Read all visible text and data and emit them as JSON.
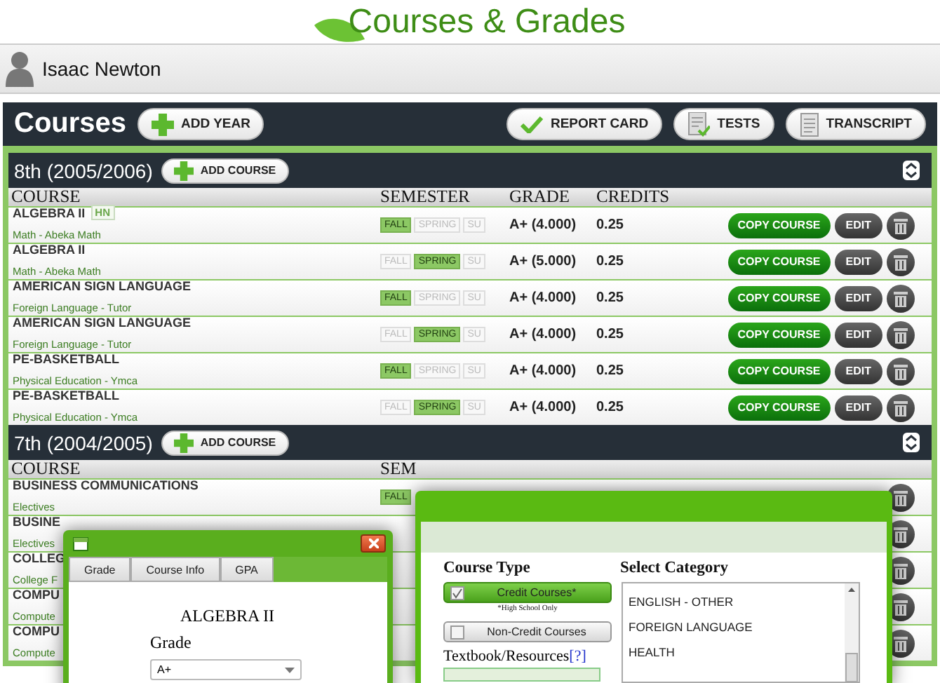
{
  "header": {
    "title": "Courses & Grades"
  },
  "user": {
    "name": "Isaac Newton"
  },
  "toolbar": {
    "title": "Courses",
    "add_button": "ADD YEAR",
    "buttons": [
      {
        "kind": "check",
        "label": "REPORT CARD"
      },
      {
        "kind": "tests",
        "label": "TESTS"
      },
      {
        "kind": "document",
        "label": "TRANSCRIPT"
      }
    ]
  },
  "years": [
    {
      "label": "8th (2005/2006)",
      "add_button": "ADD COURSE",
      "columns": [
        "COURSE",
        "SEMESTER",
        "GRADE",
        "CREDITS"
      ],
      "rows": [
        {
          "course": "ALGEBRA II",
          "honors": "HN",
          "subject": "Math - Abeka Math",
          "semesters": [
            {
              "label": "FALL",
              "selected": true
            },
            {
              "label": "SPRING",
              "selected": false
            },
            {
              "label": "SU",
              "selected": false
            }
          ],
          "grade": "A+ (4.000)",
          "credits": "0.25",
          "copy": "COPY COURSE",
          "edit": "EDIT"
        },
        {
          "course": "ALGEBRA II",
          "subject": "Math - Abeka Math",
          "semesters": [
            {
              "label": "FALL",
              "selected": false
            },
            {
              "label": "SPRING",
              "selected": true
            },
            {
              "label": "SU",
              "selected": false
            }
          ],
          "grade": "A+ (5.000)",
          "credits": "0.25",
          "copy": "COPY COURSE",
          "edit": "EDIT"
        },
        {
          "course": "AMERICAN SIGN LANGUAGE",
          "subject": "Foreign Language - Tutor",
          "semesters": [
            {
              "label": "FALL",
              "selected": true
            },
            {
              "label": "SPRING",
              "selected": false
            },
            {
              "label": "SU",
              "selected": false
            }
          ],
          "grade": "A+ (4.000)",
          "credits": "0.25",
          "copy": "COPY COURSE",
          "edit": "EDIT"
        },
        {
          "course": "AMERICAN SIGN LANGUAGE",
          "subject": "Foreign Language - Tutor",
          "semesters": [
            {
              "label": "FALL",
              "selected": false
            },
            {
              "label": "SPRING",
              "selected": true
            },
            {
              "label": "SU",
              "selected": false
            }
          ],
          "grade": "A+ (4.000)",
          "credits": "0.25",
          "copy": "COPY COURSE",
          "edit": "EDIT"
        },
        {
          "course": "PE-BASKETBALL",
          "subject": "Physical Education - Ymca",
          "semesters": [
            {
              "label": "FALL",
              "selected": true
            },
            {
              "label": "SPRING",
              "selected": false
            },
            {
              "label": "SU",
              "selected": false
            }
          ],
          "grade": "A+ (4.000)",
          "credits": "0.25",
          "copy": "COPY COURSE",
          "edit": "EDIT"
        },
        {
          "course": "PE-BASKETBALL",
          "subject": "Physical Education - Ymca",
          "semesters": [
            {
              "label": "FALL",
              "selected": false
            },
            {
              "label": "SPRING",
              "selected": true
            },
            {
              "label": "SU",
              "selected": false
            }
          ],
          "grade": "A+ (4.000)",
          "credits": "0.25",
          "copy": "COPY COURSE",
          "edit": "EDIT"
        }
      ]
    },
    {
      "label": "7th (2004/2005)",
      "add_button": "ADD COURSE",
      "columns": [
        "COURSE",
        "SEM"
      ],
      "rows": [
        {
          "course": "BUSINESS COMMUNICATIONS",
          "subject": "Electives",
          "semesters": [
            {
              "label": "FALL",
              "selected": true
            }
          ]
        },
        {
          "course": "BUSINE",
          "subject": "Electives"
        },
        {
          "course": "COLLEG",
          "subject": "College F"
        },
        {
          "course": "COMPU",
          "subject": "Compute"
        },
        {
          "course": "COMPU",
          "subject": "Compute"
        }
      ]
    }
  ],
  "grade_dialog": {
    "tabs": [
      "Grade",
      "Course Info",
      "GPA"
    ],
    "course": "ALGEBRA II",
    "grade_label": "Grade",
    "grade_value": "A+"
  },
  "category_dialog": {
    "course_type_label": "Course Type",
    "options": [
      {
        "label": "Credit Courses*",
        "checked": true
      },
      {
        "label": "Non-Credit Courses",
        "checked": false
      }
    ],
    "note": "*High School Only",
    "textbook_label": "Textbook/Resources",
    "help_link": "[?]",
    "category_label": "Select Category",
    "categories": [
      "ENGLISH - OTHER",
      "FOREIGN LANGUAGE",
      "HEALTH"
    ]
  }
}
